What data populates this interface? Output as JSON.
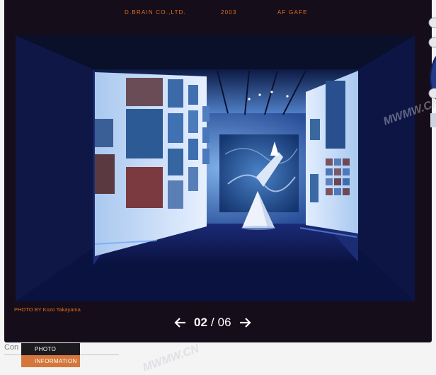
{
  "header": {
    "company": "D.BRAIN CO.,LTD.",
    "year": "2003",
    "project": "AF GAFE"
  },
  "gallery": {
    "photo_credit": "PHOTO BY Kozo Takayama",
    "current": "02",
    "separator": "/",
    "total": "06",
    "prev_icon": "arrow-left-icon",
    "next_icon": "arrow-right-icon"
  },
  "page": {
    "underlying_text": "Con"
  },
  "menu": {
    "items": [
      {
        "label": "PHOTO"
      },
      {
        "label": "INFORMATION"
      }
    ]
  },
  "watermark": "MWMW.CN",
  "colors": {
    "accent_orange": "#e0701e",
    "modal_background": "#150d19",
    "menu_active": "#d5773d"
  }
}
